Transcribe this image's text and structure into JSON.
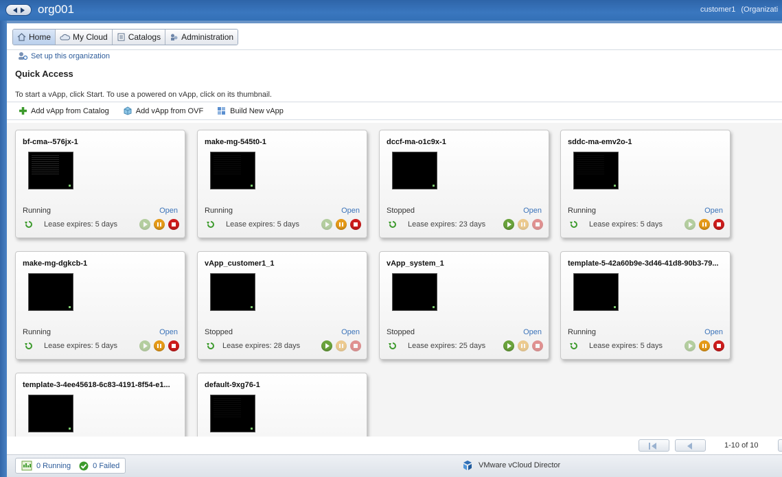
{
  "window": {
    "org_title": "org001",
    "user": "customer1",
    "user_role": "(Organizati"
  },
  "tabs": [
    {
      "label": "Home",
      "icon": "home-icon",
      "active": true
    },
    {
      "label": "My Cloud",
      "icon": "cloud-icon",
      "active": false
    },
    {
      "label": "Catalogs",
      "icon": "catalog-icon",
      "active": false
    },
    {
      "label": "Administration",
      "icon": "administration-icon",
      "active": false
    }
  ],
  "setup_link": "Set up this organization",
  "quick_access": {
    "title": "Quick Access",
    "hint": "To start a vApp, click Start. To use a powered on vApp, click on its thumbnail."
  },
  "actions": [
    {
      "label": "Add vApp from Catalog",
      "icon": "add-icon"
    },
    {
      "label": "Add vApp from OVF",
      "icon": "ovf-icon"
    },
    {
      "label": "Build New vApp",
      "icon": "build-icon"
    }
  ],
  "vapps": [
    {
      "name": "bf-cma--576jx-1",
      "status": "Running",
      "open": "Open",
      "lease": "Lease expires: 5 days"
    },
    {
      "name": "make-mg-545t0-1",
      "status": "Running",
      "open": "Open",
      "lease": "Lease expires: 5 days"
    },
    {
      "name": "dccf-ma-o1c9x-1",
      "status": "Stopped",
      "open": "Open",
      "lease": "Lease expires: 23 days"
    },
    {
      "name": "sddc-ma-emv2o-1",
      "status": "Running",
      "open": "Open",
      "lease": "Lease expires: 5 days"
    },
    {
      "name": "make-mg-dgkcb-1",
      "status": "Running",
      "open": "Open",
      "lease": "Lease expires: 5 days"
    },
    {
      "name": "vApp_customer1_1",
      "status": "Stopped",
      "open": "Open",
      "lease": "Lease expires: 28 days"
    },
    {
      "name": "vApp_system_1",
      "status": "Stopped",
      "open": "Open",
      "lease": "Lease expires: 25 days"
    },
    {
      "name": "template-5-42a60b9e-3d46-41d8-90b3-79...",
      "status": "Running",
      "open": "Open",
      "lease": "Lease expires: 5 days"
    },
    {
      "name": "template-3-4ee45618-6c83-4191-8f54-e1...",
      "status": "",
      "open": "",
      "lease": ""
    },
    {
      "name": "default-9xg76-1",
      "status": "",
      "open": "",
      "lease": ""
    }
  ],
  "pagination": {
    "range": "1-10 of 10"
  },
  "statusbar": {
    "running": "0 Running",
    "failed": "0 Failed",
    "brand": "VMware vCloud Director"
  }
}
